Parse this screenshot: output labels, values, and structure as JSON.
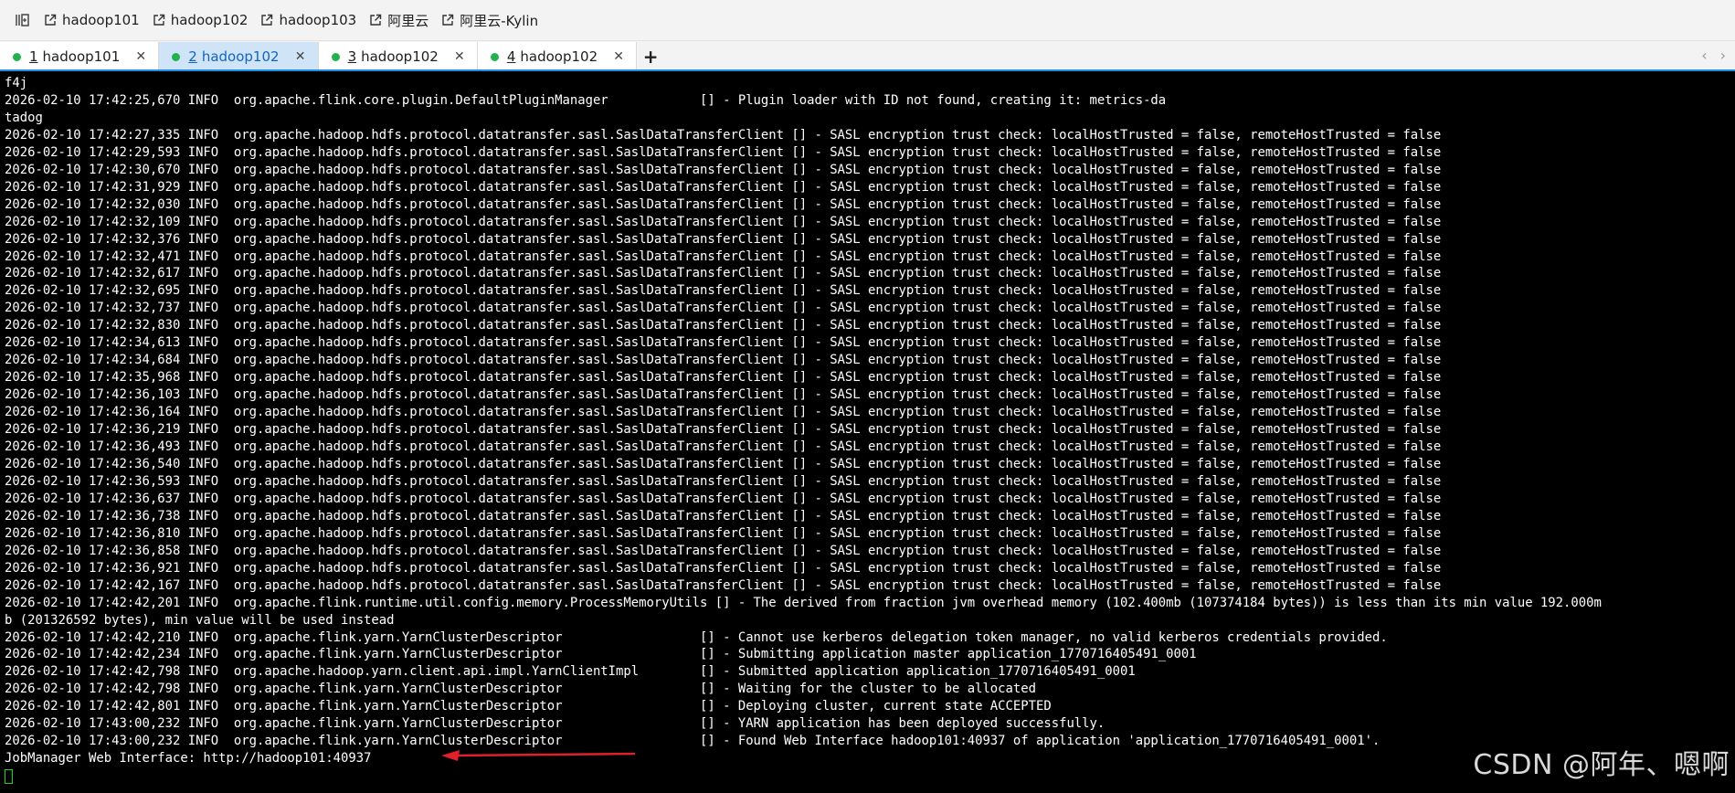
{
  "bookmarks": [
    {
      "label": "hadoop101",
      "icon": "external-link-icon"
    },
    {
      "label": "hadoop102",
      "icon": "external-link-icon"
    },
    {
      "label": "hadoop103",
      "icon": "external-link-icon"
    },
    {
      "label": "阿里云",
      "icon": "external-link-icon"
    },
    {
      "label": "阿里云-Kylin",
      "icon": "external-link-icon"
    }
  ],
  "tabs": [
    {
      "num": "1",
      "label": "hadoop101",
      "status_color": "#22b14c",
      "active": false
    },
    {
      "num": "2",
      "label": "hadoop102",
      "status_color": "#22b14c",
      "active": true
    },
    {
      "num": "3",
      "label": "hadoop102",
      "status_color": "#22b14c",
      "active": false
    },
    {
      "num": "4",
      "label": "hadoop102",
      "status_color": "#22b14c",
      "active": false
    }
  ],
  "tab_controls": {
    "add": "+",
    "prev": "‹",
    "next": "›",
    "close": "✕"
  },
  "terminal": {
    "lines": [
      "f4j",
      "2026-02-10 17:42:25,670 INFO  org.apache.flink.core.plugin.DefaultPluginManager            [] - Plugin loader with ID not found, creating it: metrics-da",
      "tadog",
      "2026-02-10 17:42:27,335 INFO  org.apache.hadoop.hdfs.protocol.datatransfer.sasl.SaslDataTransferClient [] - SASL encryption trust check: localHostTrusted = false, remoteHostTrusted = false",
      "2026-02-10 17:42:29,593 INFO  org.apache.hadoop.hdfs.protocol.datatransfer.sasl.SaslDataTransferClient [] - SASL encryption trust check: localHostTrusted = false, remoteHostTrusted = false",
      "2026-02-10 17:42:30,670 INFO  org.apache.hadoop.hdfs.protocol.datatransfer.sasl.SaslDataTransferClient [] - SASL encryption trust check: localHostTrusted = false, remoteHostTrusted = false",
      "2026-02-10 17:42:31,929 INFO  org.apache.hadoop.hdfs.protocol.datatransfer.sasl.SaslDataTransferClient [] - SASL encryption trust check: localHostTrusted = false, remoteHostTrusted = false",
      "2026-02-10 17:42:32,030 INFO  org.apache.hadoop.hdfs.protocol.datatransfer.sasl.SaslDataTransferClient [] - SASL encryption trust check: localHostTrusted = false, remoteHostTrusted = false",
      "2026-02-10 17:42:32,109 INFO  org.apache.hadoop.hdfs.protocol.datatransfer.sasl.SaslDataTransferClient [] - SASL encryption trust check: localHostTrusted = false, remoteHostTrusted = false",
      "2026-02-10 17:42:32,376 INFO  org.apache.hadoop.hdfs.protocol.datatransfer.sasl.SaslDataTransferClient [] - SASL encryption trust check: localHostTrusted = false, remoteHostTrusted = false",
      "2026-02-10 17:42:32,471 INFO  org.apache.hadoop.hdfs.protocol.datatransfer.sasl.SaslDataTransferClient [] - SASL encryption trust check: localHostTrusted = false, remoteHostTrusted = false",
      "2026-02-10 17:42:32,617 INFO  org.apache.hadoop.hdfs.protocol.datatransfer.sasl.SaslDataTransferClient [] - SASL encryption trust check: localHostTrusted = false, remoteHostTrusted = false",
      "2026-02-10 17:42:32,695 INFO  org.apache.hadoop.hdfs.protocol.datatransfer.sasl.SaslDataTransferClient [] - SASL encryption trust check: localHostTrusted = false, remoteHostTrusted = false",
      "2026-02-10 17:42:32,737 INFO  org.apache.hadoop.hdfs.protocol.datatransfer.sasl.SaslDataTransferClient [] - SASL encryption trust check: localHostTrusted = false, remoteHostTrusted = false",
      "2026-02-10 17:42:32,830 INFO  org.apache.hadoop.hdfs.protocol.datatransfer.sasl.SaslDataTransferClient [] - SASL encryption trust check: localHostTrusted = false, remoteHostTrusted = false",
      "2026-02-10 17:42:34,613 INFO  org.apache.hadoop.hdfs.protocol.datatransfer.sasl.SaslDataTransferClient [] - SASL encryption trust check: localHostTrusted = false, remoteHostTrusted = false",
      "2026-02-10 17:42:34,684 INFO  org.apache.hadoop.hdfs.protocol.datatransfer.sasl.SaslDataTransferClient [] - SASL encryption trust check: localHostTrusted = false, remoteHostTrusted = false",
      "2026-02-10 17:42:35,968 INFO  org.apache.hadoop.hdfs.protocol.datatransfer.sasl.SaslDataTransferClient [] - SASL encryption trust check: localHostTrusted = false, remoteHostTrusted = false",
      "2026-02-10 17:42:36,103 INFO  org.apache.hadoop.hdfs.protocol.datatransfer.sasl.SaslDataTransferClient [] - SASL encryption trust check: localHostTrusted = false, remoteHostTrusted = false",
      "2026-02-10 17:42:36,164 INFO  org.apache.hadoop.hdfs.protocol.datatransfer.sasl.SaslDataTransferClient [] - SASL encryption trust check: localHostTrusted = false, remoteHostTrusted = false",
      "2026-02-10 17:42:36,219 INFO  org.apache.hadoop.hdfs.protocol.datatransfer.sasl.SaslDataTransferClient [] - SASL encryption trust check: localHostTrusted = false, remoteHostTrusted = false",
      "2026-02-10 17:42:36,493 INFO  org.apache.hadoop.hdfs.protocol.datatransfer.sasl.SaslDataTransferClient [] - SASL encryption trust check: localHostTrusted = false, remoteHostTrusted = false",
      "2026-02-10 17:42:36,540 INFO  org.apache.hadoop.hdfs.protocol.datatransfer.sasl.SaslDataTransferClient [] - SASL encryption trust check: localHostTrusted = false, remoteHostTrusted = false",
      "2026-02-10 17:42:36,593 INFO  org.apache.hadoop.hdfs.protocol.datatransfer.sasl.SaslDataTransferClient [] - SASL encryption trust check: localHostTrusted = false, remoteHostTrusted = false",
      "2026-02-10 17:42:36,637 INFO  org.apache.hadoop.hdfs.protocol.datatransfer.sasl.SaslDataTransferClient [] - SASL encryption trust check: localHostTrusted = false, remoteHostTrusted = false",
      "2026-02-10 17:42:36,738 INFO  org.apache.hadoop.hdfs.protocol.datatransfer.sasl.SaslDataTransferClient [] - SASL encryption trust check: localHostTrusted = false, remoteHostTrusted = false",
      "2026-02-10 17:42:36,810 INFO  org.apache.hadoop.hdfs.protocol.datatransfer.sasl.SaslDataTransferClient [] - SASL encryption trust check: localHostTrusted = false, remoteHostTrusted = false",
      "2026-02-10 17:42:36,858 INFO  org.apache.hadoop.hdfs.protocol.datatransfer.sasl.SaslDataTransferClient [] - SASL encryption trust check: localHostTrusted = false, remoteHostTrusted = false",
      "2026-02-10 17:42:36,921 INFO  org.apache.hadoop.hdfs.protocol.datatransfer.sasl.SaslDataTransferClient [] - SASL encryption trust check: localHostTrusted = false, remoteHostTrusted = false",
      "2026-02-10 17:42:42,167 INFO  org.apache.hadoop.hdfs.protocol.datatransfer.sasl.SaslDataTransferClient [] - SASL encryption trust check: localHostTrusted = false, remoteHostTrusted = false",
      "2026-02-10 17:42:42,201 INFO  org.apache.flink.runtime.util.config.memory.ProcessMemoryUtils [] - The derived from fraction jvm overhead memory (102.400mb (107374184 bytes)) is less than its min value 192.000m",
      "b (201326592 bytes), min value will be used instead",
      "2026-02-10 17:42:42,210 INFO  org.apache.flink.yarn.YarnClusterDescriptor                  [] - Cannot use kerberos delegation token manager, no valid kerberos credentials provided.",
      "2026-02-10 17:42:42,234 INFO  org.apache.flink.yarn.YarnClusterDescriptor                  [] - Submitting application master application_1770716405491_0001",
      "2026-02-10 17:42:42,798 INFO  org.apache.hadoop.yarn.client.api.impl.YarnClientImpl        [] - Submitted application application_1770716405491_0001",
      "2026-02-10 17:42:42,798 INFO  org.apache.flink.yarn.YarnClusterDescriptor                  [] - Waiting for the cluster to be allocated",
      "2026-02-10 17:42:42,801 INFO  org.apache.flink.yarn.YarnClusterDescriptor                  [] - Deploying cluster, current state ACCEPTED",
      "2026-02-10 17:43:00,232 INFO  org.apache.flink.yarn.YarnClusterDescriptor                  [] - YARN application has been deployed successfully.",
      "2026-02-10 17:43:00,232 INFO  org.apache.flink.yarn.YarnClusterDescriptor                  [] - Found Web Interface hadoop101:40937 of application 'application_1770716405491_0001'.",
      "JobManager Web Interface: http://hadoop101:40937"
    ],
    "text_color": "#ffffff",
    "cursor_color": "#19d219"
  },
  "annotation": {
    "arrow_color": "#e0202a"
  },
  "watermark": "CSDN @阿年、嗯啊"
}
